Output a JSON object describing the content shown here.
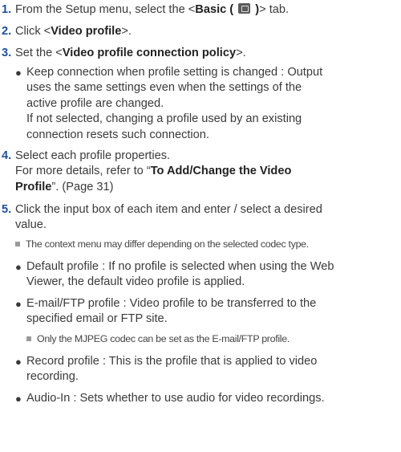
{
  "steps": [
    {
      "num": "1.",
      "pre": "From the Setup menu, select the <",
      "bold": "Basic ( ",
      "bold_end": " )",
      "post": "> tab."
    },
    {
      "num": "2.",
      "pre": "Click <",
      "bold": "Video profile",
      "post": ">."
    },
    {
      "num": "3.",
      "pre": "Set the <",
      "bold": "Video profile connection policy",
      "post": ">."
    },
    {
      "num": "4.",
      "line1": "Select each profile properties.",
      "line2_pre": "For more details, refer to “",
      "line2_bold": "To Add/Change the Video",
      "line3_bold": "Profile",
      "line3_post": "”. (Page 31)"
    },
    {
      "num": "5.",
      "line1": "Click the input box of each item and enter / select a desired",
      "line2": "value."
    }
  ],
  "step3_bullet": {
    "lines": [
      "Keep connection when profile setting is changed : Output",
      "uses the same settings even when the settings of the",
      "active profile are changed.",
      "If not selected, changing a profile used by an existing",
      "connection resets such connection."
    ]
  },
  "step5_note": "The context menu may differ depending on the selected codec type.",
  "step5_bullets": [
    {
      "lines": [
        "Default profile : If no profile is selected when using the Web",
        "Viewer, the default video profile is applied."
      ]
    },
    {
      "lines": [
        "E-mail/FTP profile : Video profile to be transferred to the",
        "specified email or FTP site."
      ]
    },
    {
      "lines": [
        "Record profile : This is the profile that is applied to video",
        "recording."
      ]
    },
    {
      "lines": [
        "Audio-In : Sets whether to use audio for video recordings."
      ]
    }
  ],
  "email_note": "Only the MJPEG codec can be set as the E-mail/FTP profile.",
  "icons": {
    "basic_tab": "basic-settings-icon",
    "bullet": "bullet-dot",
    "note": "square-note-marker"
  }
}
